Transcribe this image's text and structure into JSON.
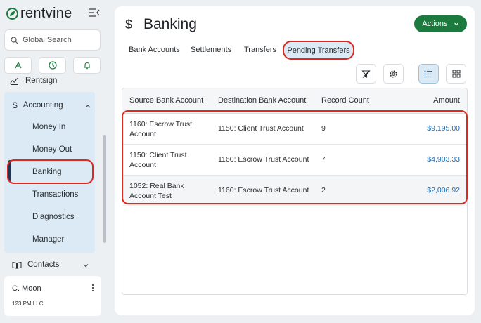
{
  "brand": {
    "name": "rentvine"
  },
  "sidebar": {
    "search_placeholder": "Global Search",
    "rentsign": "Rentsign",
    "accounting": {
      "label": "Accounting",
      "items": [
        {
          "label": "Money In"
        },
        {
          "label": "Money Out"
        },
        {
          "label": "Banking"
        },
        {
          "label": "Transactions"
        },
        {
          "label": "Diagnostics"
        },
        {
          "label": "Manager"
        }
      ]
    },
    "contacts": "Contacts",
    "user": {
      "name": "C. Moon",
      "org": "123 PM LLC"
    }
  },
  "page": {
    "title": "Banking",
    "actions_label": "Actions",
    "tabs": [
      {
        "label": "Bank Accounts"
      },
      {
        "label": "Settlements"
      },
      {
        "label": "Transfers"
      },
      {
        "label": "Pending Transfers"
      }
    ]
  },
  "table": {
    "columns": [
      "Source Bank Account",
      "Destination Bank Account",
      "Record Count",
      "Amount"
    ],
    "rows": [
      {
        "source": "1160: Escrow Trust Account",
        "destination": "1150: Client Trust Account",
        "count": "9",
        "amount": "$9,195.00"
      },
      {
        "source": "1150: Client Trust Account",
        "destination": "1160: Escrow Trust Account",
        "count": "7",
        "amount": "$4,903.33"
      },
      {
        "source": "1052: Real Bank Account Test",
        "destination": "1160: Escrow Trust Account",
        "count": "2",
        "amount": "$2,006.92"
      }
    ]
  },
  "colors": {
    "accent_green": "#1c7a3e",
    "highlight_red": "#e0281d",
    "active_blue": "#dbeaf5",
    "amount_blue": "#1f6fb8"
  }
}
